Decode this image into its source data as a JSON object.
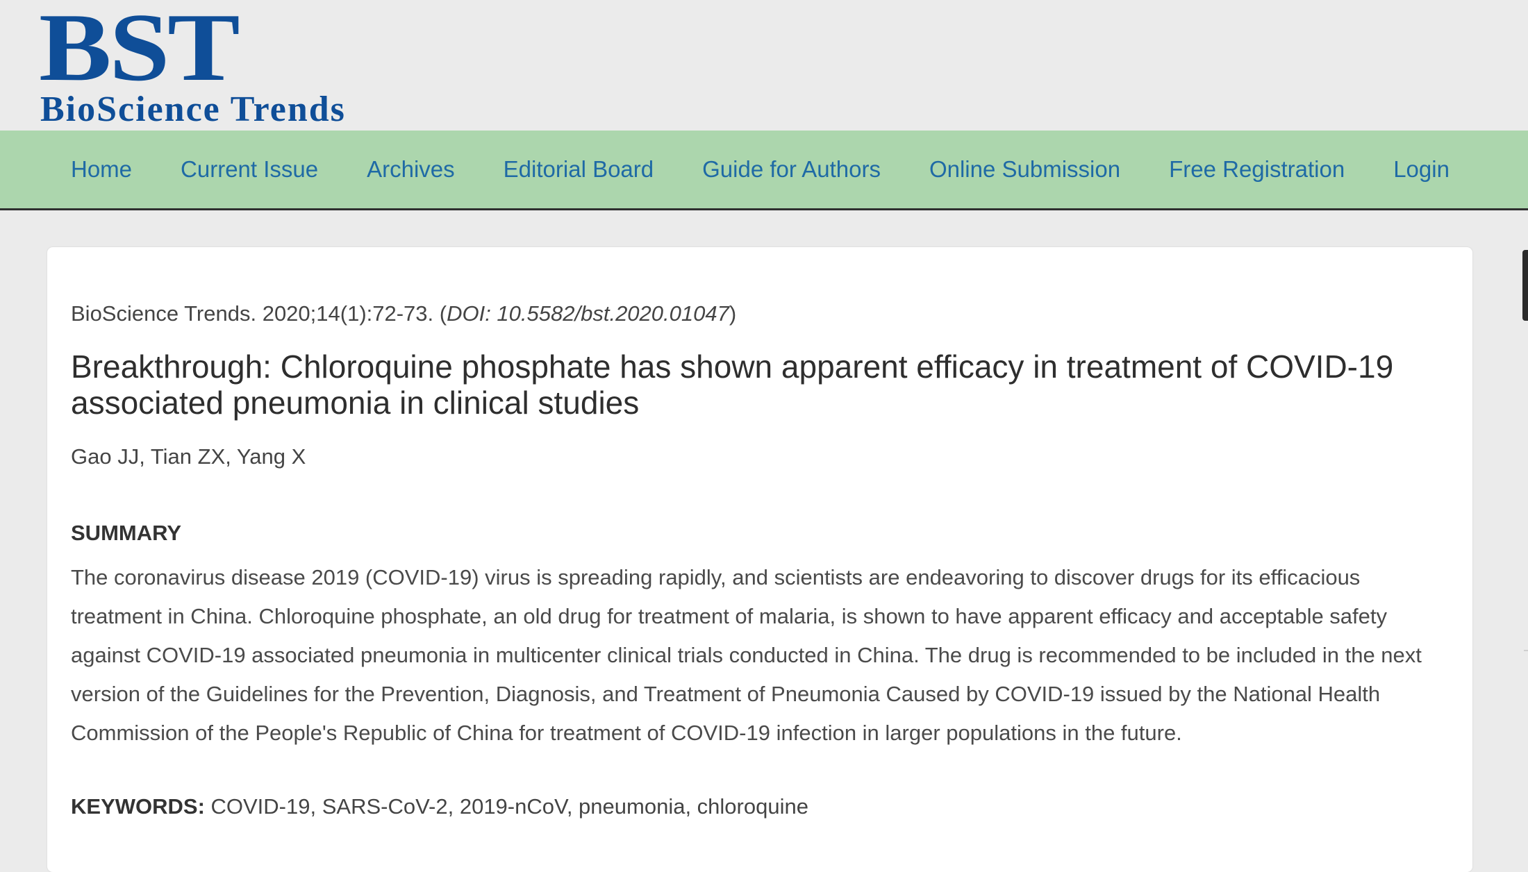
{
  "brand": {
    "mark": "BST",
    "name": "BioScience Trends",
    "color": "#0f4e98"
  },
  "nav": {
    "items": [
      {
        "label": "Home"
      },
      {
        "label": "Current Issue"
      },
      {
        "label": "Archives"
      },
      {
        "label": "Editorial Board"
      },
      {
        "label": "Guide for Authors"
      },
      {
        "label": "Online Submission"
      },
      {
        "label": "Free Registration"
      },
      {
        "label": "Login"
      }
    ],
    "background": "#acd6ad",
    "link_color": "#1f6aa5"
  },
  "article": {
    "citation_prefix": "BioScience Trends. 2020;14(1):72-73. (",
    "doi": "DOI: 10.5582/bst.2020.01047",
    "citation_suffix": ")",
    "title": "Breakthrough: Chloroquine phosphate has shown apparent efficacy in treatment of COVID-19 associated pneumonia in clinical studies",
    "authors": "Gao JJ, Tian ZX, Yang X",
    "summary_heading": "SUMMARY",
    "summary_text": "The coronavirus disease 2019 (COVID-19) virus is spreading rapidly, and scientists are endeavoring to discover drugs for its efficacious treatment in China. Chloroquine phosphate, an old drug for treatment of malaria, is shown to have apparent efficacy and acceptable safety against COVID-19 associated pneumonia in multicenter clinical trials conducted in China. The drug is recommended to be included in the next version of the Guidelines for the Prevention, Diagnosis, and Treatment of Pneumonia Caused by COVID-19 issued by the National Health Commission of the People's Republic of China for treatment of COVID-19 infection in larger populations in the future.",
    "keywords_label": "KEYWORDS:",
    "keywords_value": " COVID-19, SARS-CoV-2, 2019-nCoV, pneumonia, chloroquine"
  }
}
